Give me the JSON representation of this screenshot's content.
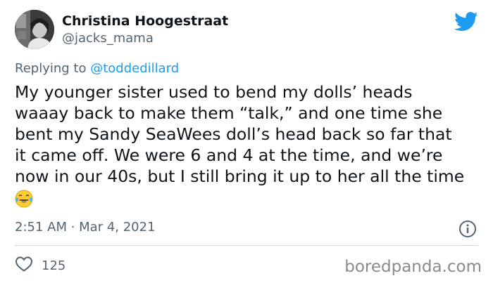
{
  "author": {
    "name": "Christina Hoogestraat",
    "handle": "@jacks_mama"
  },
  "reply": {
    "prefix": "Replying to ",
    "handle": "@toddedillard"
  },
  "tweet": {
    "lines": [
      "My younger sister used to bend my dolls’ heads",
      "waaay back to make them “talk,” and one time she",
      "bent my Sandy SeaWees doll’s head back so far that",
      "it came off. We were 6 and 4 at the time, and we’re",
      "now in our 40s, but I still bring it up to her all the time"
    ],
    "emoji": "face-with-tears-of-joy"
  },
  "meta": {
    "timestamp": "2:51 AM · Mar 4, 2021"
  },
  "stats": {
    "likes": "125"
  },
  "watermark": "boredpanda.com",
  "colors": {
    "twitter_blue": "#1d9bf0",
    "secondary_text": "#536471",
    "primary_text": "#0f1419"
  },
  "icons": [
    "twitter-bird-icon",
    "info-icon",
    "heart-icon",
    "face-with-tears-of-joy-emoji"
  ]
}
